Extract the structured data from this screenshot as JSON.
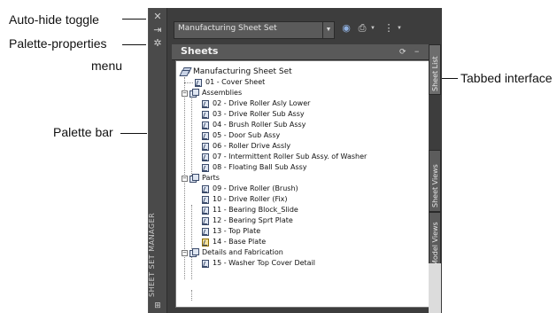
{
  "callouts": {
    "auto_hide": "Auto-hide toggle",
    "palette_properties": "Palette-properties",
    "palette_properties_2": "menu",
    "palette_bar": "Palette bar",
    "tabbed_interface": "Tabbed interface"
  },
  "palette": {
    "vertical_title": "SHEET SET MANAGER",
    "selector_value": "Manufacturing Sheet Set",
    "panel_title": "Sheets",
    "tabs": [
      "Sheet List",
      "Sheet Views",
      "Model Views"
    ]
  },
  "tree": {
    "root": "Manufacturing Sheet Set",
    "items": [
      "01 - Cover Sheet",
      "Assemblies",
      "02 - Drive Roller Asly Lower",
      "03 - Drive Roller Sub Assy",
      "04 - Brush Roller Sub Assy",
      "05 - Door Sub Assy",
      "06 - Roller Drive Assly",
      "07 - Intermittent Roller Sub Assy. of Washer",
      "08 - Floating Ball Sub Assy",
      "Parts",
      "09 - Drive Roller (Brush)",
      "10 - Drive Roller (Fix)",
      "11 - Bearing Block_Slide",
      "12 - Bearing Sprt Plate",
      "13 - Top Plate",
      "14 - Base Plate",
      "Details and Fabrication",
      "15 - Washer Top Cover Detail"
    ]
  },
  "icons": {
    "close": "close-icon",
    "auto_hide": "pin-icon",
    "properties": "gear-icon"
  }
}
